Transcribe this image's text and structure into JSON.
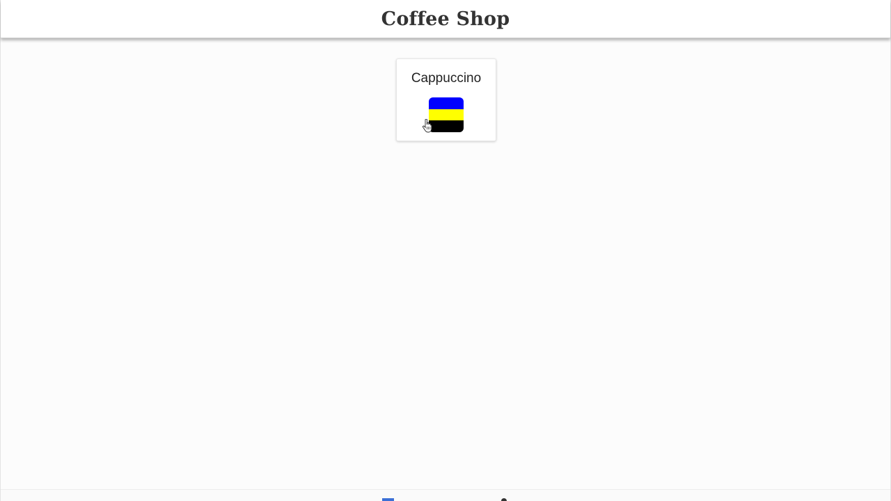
{
  "header": {
    "title": "Coffee Shop"
  },
  "products": [
    {
      "name": "Cappuccino",
      "icon": "cappuccino-icon",
      "icon_colors": [
        "#0000ff",
        "#ffff00",
        "#000000"
      ]
    }
  ],
  "colors": {
    "background": "#fcfcfc",
    "header_background": "#ffffff",
    "title_text": "#333333"
  }
}
